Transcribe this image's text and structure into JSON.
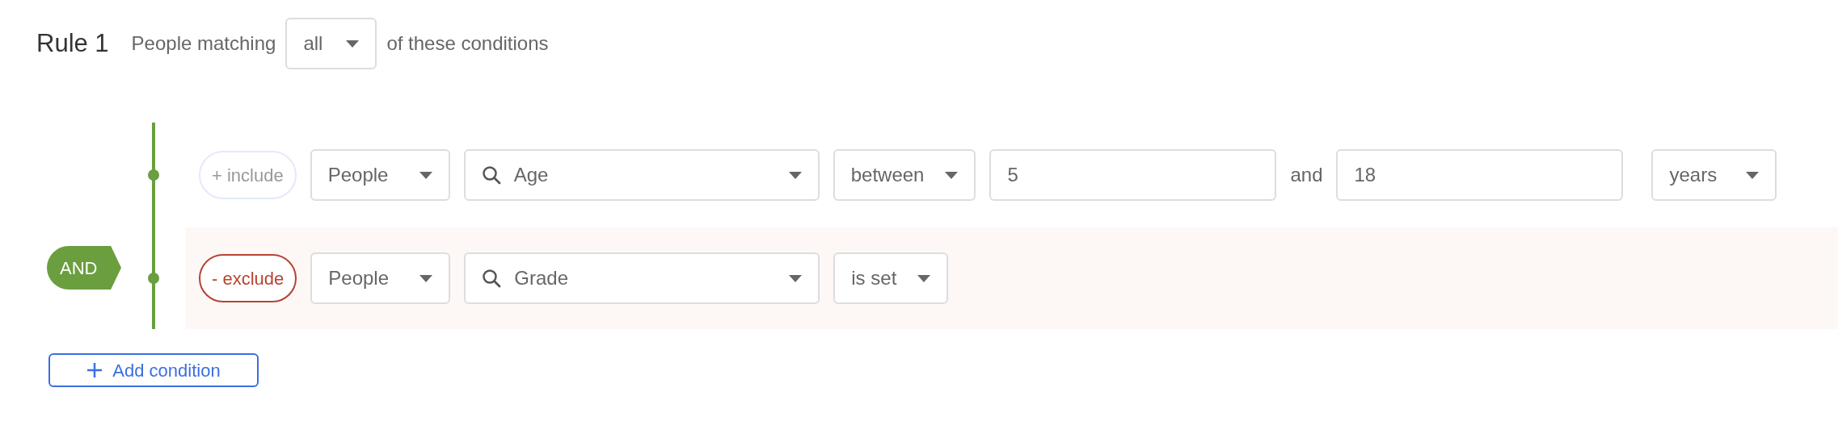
{
  "rule": {
    "title": "Rule 1",
    "prefix": "People matching",
    "match": "all",
    "suffix": "of these conditions"
  },
  "connector": "AND",
  "conditions": [
    {
      "kind": "include",
      "mode_label": "+ include",
      "entity": "People",
      "field": "Age",
      "operator": "between",
      "values": [
        "5",
        "18"
      ],
      "joiner": "and",
      "unit": "years"
    },
    {
      "kind": "exclude",
      "mode_label": "- exclude",
      "entity": "People",
      "field": "Grade",
      "operator": "is set"
    }
  ],
  "add_button": "Add condition"
}
